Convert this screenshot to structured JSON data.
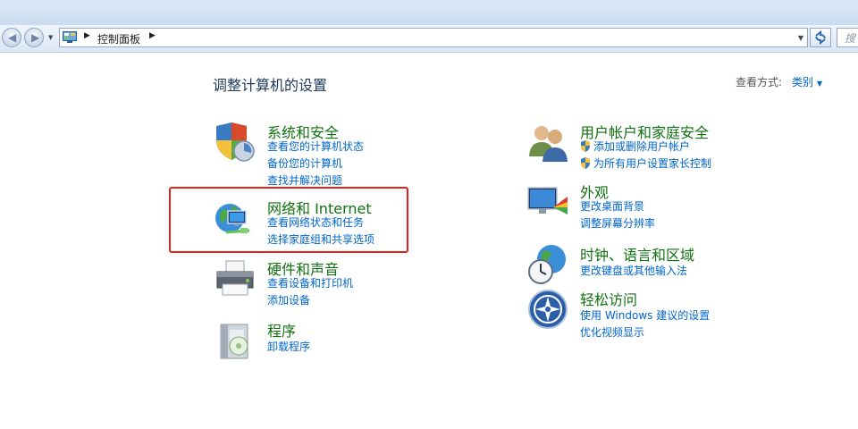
{
  "address_bar": {
    "breadcrumb": "控制面板",
    "search_placeholder": "搜"
  },
  "page": {
    "title": "调整计算机的设置",
    "view_by_label": "查看方式:",
    "view_by_value": "类别"
  },
  "left_categories": [
    {
      "icon": "shield-security-icon",
      "title": "系统和安全",
      "links": [
        "查看您的计算机状态",
        "备份您的计算机",
        "查找并解决问题"
      ]
    },
    {
      "icon": "network-globe-icon",
      "title": "网络和 Internet",
      "links": [
        "查看网络状态和任务",
        "选择家庭组和共享选项"
      ]
    },
    {
      "icon": "printer-icon",
      "title": "硬件和声音",
      "links": [
        "查看设备和打印机",
        "添加设备"
      ]
    },
    {
      "icon": "programs-box-icon",
      "title": "程序",
      "links": [
        "卸载程序"
      ]
    }
  ],
  "right_categories": [
    {
      "icon": "users-icon",
      "title": "用户帐户和家庭安全",
      "links": [
        "添加或删除用户帐户",
        "为所有用户设置家长控制"
      ]
    },
    {
      "icon": "appearance-monitor-icon",
      "title": "外观",
      "links": [
        "更改桌面背景",
        "调整屏幕分辨率"
      ]
    },
    {
      "icon": "clock-globe-icon",
      "title": "时钟、语言和区域",
      "links": [
        "更改键盘或其他输入法"
      ]
    },
    {
      "icon": "ease-of-access-icon",
      "title": "轻松访问",
      "links": [
        "使用 Windows 建议的设置",
        "优化视频显示"
      ]
    }
  ],
  "colors": {
    "category_title": "#107010",
    "link": "#0066cc",
    "highlight_box": "#e0241c"
  }
}
